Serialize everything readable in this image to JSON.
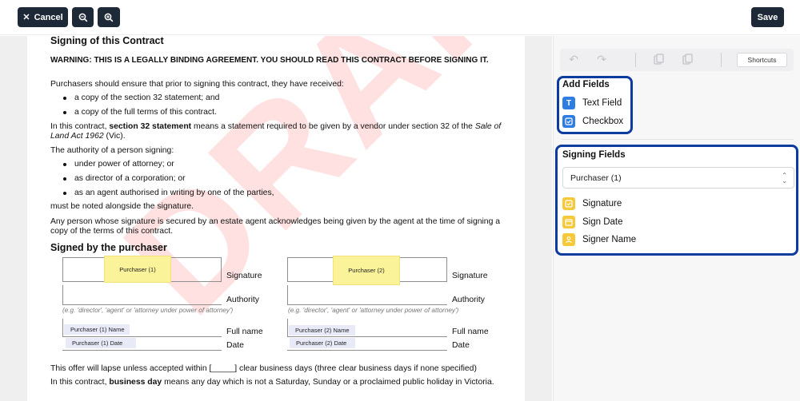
{
  "toolbar": {
    "cancel_label": "Cancel",
    "save_label": "Save",
    "shortcuts_label": "Shortcuts"
  },
  "document": {
    "title": "Signing of this Contract",
    "warning": "WARNING: THIS IS A LEGALLY BINDING AGREEMENT. YOU SHOULD READ THIS CONTRACT BEFORE SIGNING IT.",
    "p1": "Purchasers should ensure that prior to signing this contract, they have received:",
    "bullets1": [
      "a copy of the section 32 statement; and",
      "a copy of the full terms of this contract."
    ],
    "p2_a": "In this contract, ",
    "p2_b": "section 32 statement",
    "p2_c": " means a statement required to be given by a vendor under section 32 of the ",
    "p2_d": "Sale of",
    "p2_e": "Land Act 1962",
    "p2_f": " (Vic).",
    "p3": "The authority of a person signing:",
    "bullets2": [
      "under power of attorney; or",
      "as director of a corporation; or",
      "as an agent authorised in writing by one of the parties,"
    ],
    "p4": "must be noted alongside the signature.",
    "p5_line1": "Any person whose signature is secured by an estate agent acknowledges being given by the agent at the time of signing a",
    "p5_line2": "copy of the terms of this contract.",
    "signed_heading": "Signed by the purchaser",
    "signature_label": "Signature",
    "authority_label": "Authority",
    "fullname_label": "Full name",
    "date_label": "Date",
    "authority_hint": "(e.g. 'director', 'agent' or 'attorney under power of attorney')",
    "purchaser1": {
      "sig": "Purchaser (1)",
      "name": "Purchaser (1) Name",
      "date": "Purchaser (1) Date"
    },
    "purchaser2": {
      "sig": "Purchaser (2)",
      "name": "Purchaser (2) Name",
      "date": "Purchaser (2) Date"
    },
    "p6": "This offer will lapse unless accepted within [_____] clear business days (three clear business days if none specified)",
    "p7_a": "In this contract, ",
    "p7_b": "business day",
    "p7_c": " means any day which is not a Saturday, Sunday or a proclaimed public holiday in Victoria.",
    "watermark": "DRAFT"
  },
  "add_fields": {
    "title": "Add Fields",
    "items": [
      {
        "label": "Text Field",
        "icon": "text-field-icon"
      },
      {
        "label": "Checkbox",
        "icon": "checkbox-icon"
      }
    ]
  },
  "signing_fields": {
    "title": "Signing Fields",
    "selected_signer": "Purchaser (1)",
    "items": [
      {
        "label": "Signature",
        "icon": "signature-icon"
      },
      {
        "label": "Sign Date",
        "icon": "calendar-icon"
      },
      {
        "label": "Signer Name",
        "icon": "person-icon"
      }
    ]
  },
  "colors": {
    "accent_dark": "#1e2937",
    "highlight_border": "#0d3b9e",
    "field_blue": "#2f7de1",
    "field_yellow": "#f6c93b",
    "signature_highlight": "#fbf39a",
    "watermark": "#ff4646"
  }
}
